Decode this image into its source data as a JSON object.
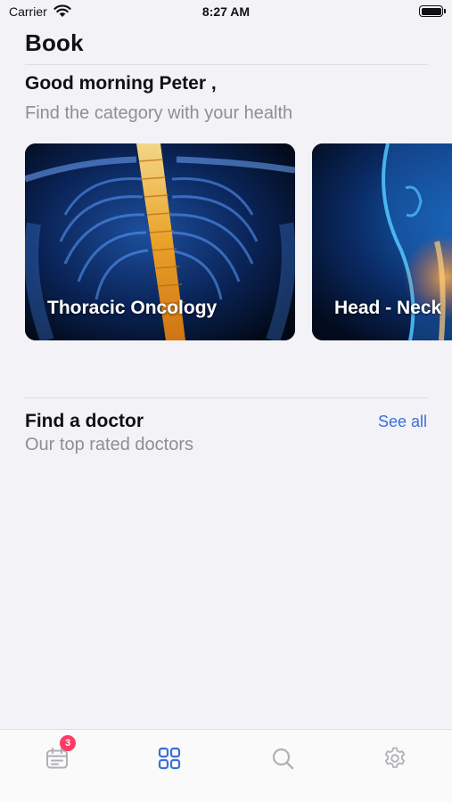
{
  "status_bar": {
    "carrier": "Carrier",
    "time": "8:27 AM",
    "icons": [
      "wifi-icon",
      "battery-icon"
    ]
  },
  "header": {
    "title": "Book"
  },
  "greeting": {
    "title": "Good morning Peter ,",
    "subtitle": "Find the category with your health"
  },
  "categories": [
    {
      "label": "Thoracic Oncology",
      "image": "thoracic-spine-xray-image"
    },
    {
      "label": "Head - Neck",
      "image": "head-neck-xray-image"
    }
  ],
  "doctors_section": {
    "title": "Find a doctor",
    "subtitle": "Our top rated doctors",
    "see_all_label": "See all"
  },
  "tab_bar": {
    "tabs": [
      {
        "icon": "calendar-icon",
        "badge": "3",
        "active": false
      },
      {
        "icon": "grid-icon",
        "active": true
      },
      {
        "icon": "search-icon",
        "active": false
      },
      {
        "icon": "gear-icon",
        "active": false
      }
    ],
    "active_color": "#3a6fd8",
    "inactive_color": "#b0b0b6",
    "badge_color": "#ff3b66"
  },
  "colors": {
    "background": "#f2f2f7",
    "link": "#3a6fd8",
    "secondary_text": "#8e8e93"
  }
}
